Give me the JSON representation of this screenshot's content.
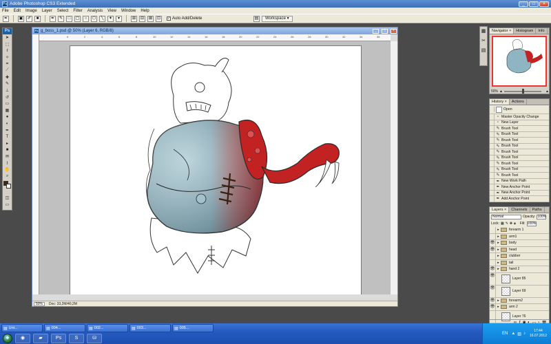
{
  "app": {
    "title": "Adobe Photoshop CS3 Extended",
    "logo_text": "Ps"
  },
  "window_controls": {
    "minimize": "_",
    "maximize": "□",
    "close": "×"
  },
  "menu": [
    "File",
    "Edit",
    "Image",
    "Layer",
    "Select",
    "Filter",
    "Analysis",
    "View",
    "Window",
    "Help"
  ],
  "options_bar": {
    "auto_add_delete_label": "Auto Add/Delete",
    "auto_add_delete_checked": true,
    "workspace_label": "Workspace ▾"
  },
  "document": {
    "title": "g_boss_1.psd @ 50% (Layer 6, RGB/8)",
    "zoom": "50%",
    "doc_info": "Doc: 33,2M/40,2M",
    "ruler_ticks": [
      "0",
      "2",
      "4",
      "6",
      "8",
      "10",
      "12",
      "14",
      "16",
      "18",
      "20",
      "22",
      "24",
      "26",
      "28",
      "30",
      "32",
      "34",
      "36"
    ]
  },
  "navigator": {
    "tabs": [
      "Navigator ×",
      "Histogram",
      "Info"
    ],
    "zoom": "50%"
  },
  "history": {
    "tabs": [
      "History ×",
      "Actions"
    ],
    "items": [
      "Open",
      "Master Opacity Change",
      "New Layer",
      "Brush Tool",
      "Brush Tool",
      "Brush Tool",
      "Brush Tool",
      "Brush Tool",
      "Brush Tool",
      "Brush Tool",
      "Brush Tool",
      "Brush Tool",
      "New Work Path",
      "New Anchor Point",
      "New Anchor Point",
      "Add Anchor Point"
    ]
  },
  "layers": {
    "tabs": [
      "Layers ×",
      "Channels",
      "Paths"
    ],
    "blend_mode": "Normal",
    "opacity_label": "Opacity:",
    "opacity": "100%",
    "lock_label": "Lock:",
    "fill_label": "Fill:",
    "fill": "100%",
    "items": [
      {
        "name": "forearm 1",
        "type": "group",
        "visible": false
      },
      {
        "name": "arm1",
        "type": "group",
        "visible": false
      },
      {
        "name": "body",
        "type": "group",
        "visible": true
      },
      {
        "name": "head",
        "type": "group",
        "visible": true
      },
      {
        "name": "clubber",
        "type": "group",
        "visible": false
      },
      {
        "name": "tail",
        "type": "group",
        "visible": false
      },
      {
        "name": "hand 2",
        "type": "group",
        "visible": true
      },
      {
        "name": "Layer 85",
        "type": "layer",
        "visible": true
      },
      {
        "name": "Layer 69",
        "type": "layer",
        "visible": true
      },
      {
        "name": "forearm2",
        "type": "group",
        "visible": true
      },
      {
        "name": "arm 2",
        "type": "group",
        "visible": true
      },
      {
        "name": "Layer 76",
        "type": "layer",
        "visible": false
      },
      {
        "name": "Layer 6",
        "type": "layer",
        "visible": true,
        "selected": true
      }
    ]
  },
  "taskbar": {
    "buttons": [
      {
        "label": "Unt...",
        "icon": "doc-icon"
      },
      {
        "label": "004...",
        "icon": "doc-icon"
      },
      {
        "label": "002...",
        "icon": "doc-icon"
      },
      {
        "label": "003...",
        "icon": "doc-icon"
      },
      {
        "label": "005...",
        "icon": "doc-icon"
      }
    ],
    "quick_launch": [
      "firefox-icon",
      "folder-icon",
      "photoshop-icon",
      "skype-icon",
      "network-icon"
    ],
    "language": "EN",
    "time": "17:44",
    "date": "16.07.2012"
  },
  "colors": {
    "accent": "#3169c6",
    "creature_red": "#c62424",
    "creature_blue": "#8ab6c6"
  }
}
